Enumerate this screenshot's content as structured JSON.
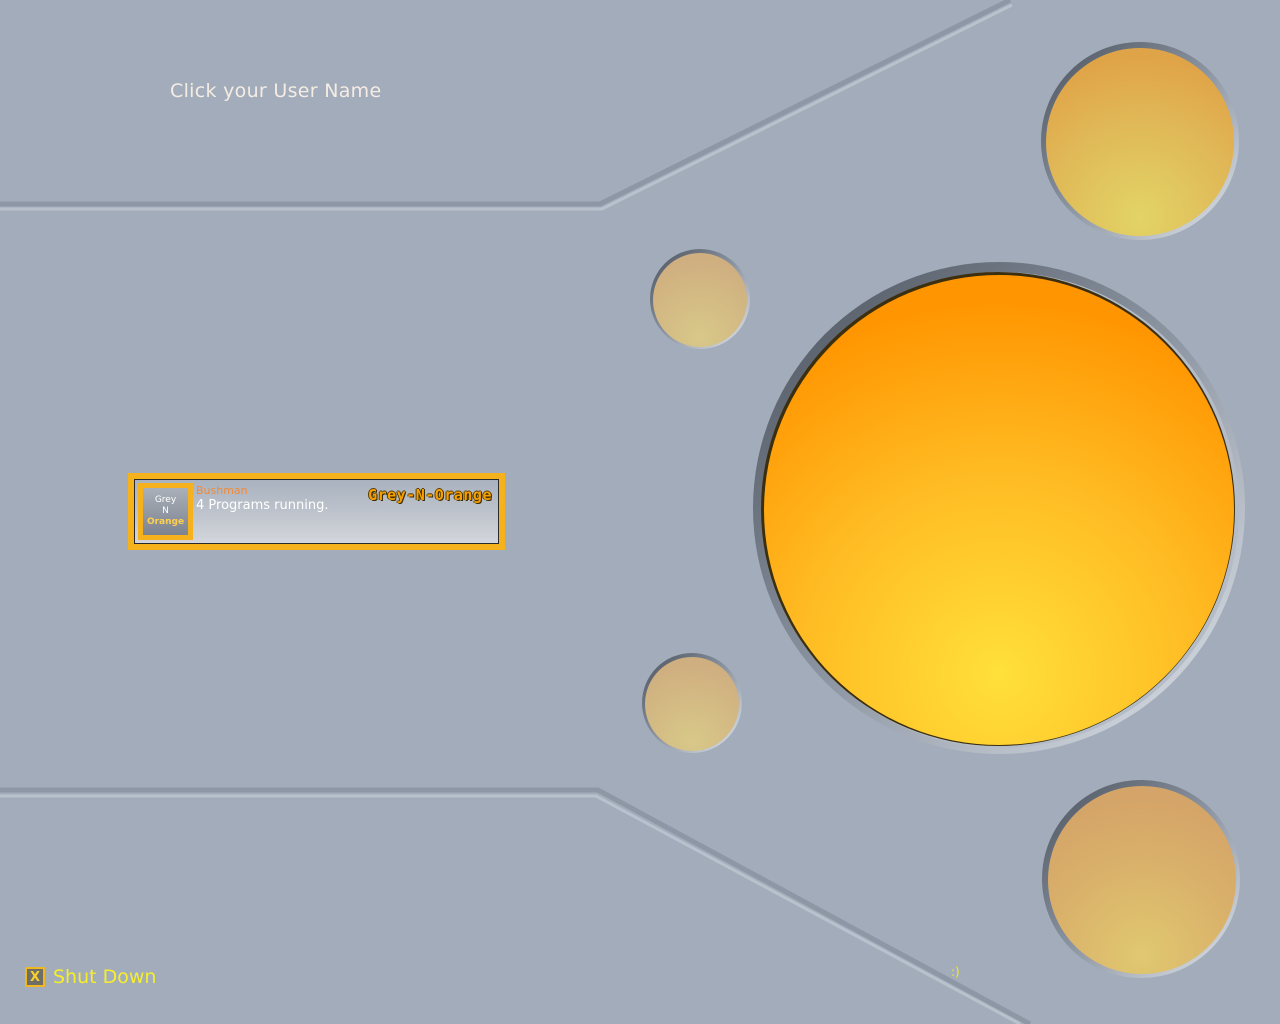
{
  "instruction": "Click your User Name",
  "users": [
    {
      "name": "Bushman",
      "status": "4 Programs running.",
      "avatar_lines": [
        "Grey",
        "N",
        "Orange"
      ],
      "theme_label": "Grey-N-Orange"
    }
  ],
  "shutdown": {
    "label": "Shut Down",
    "icon_glyph": "X",
    "icon": "shutdown-icon"
  },
  "smiley": ":)",
  "colors": {
    "background": "#a2acba",
    "accent_orange": "#f5b21c",
    "shutdown_text": "#f7ee2a",
    "instruction_text": "#f5ece4",
    "user_name_text": "#f08a3a"
  }
}
